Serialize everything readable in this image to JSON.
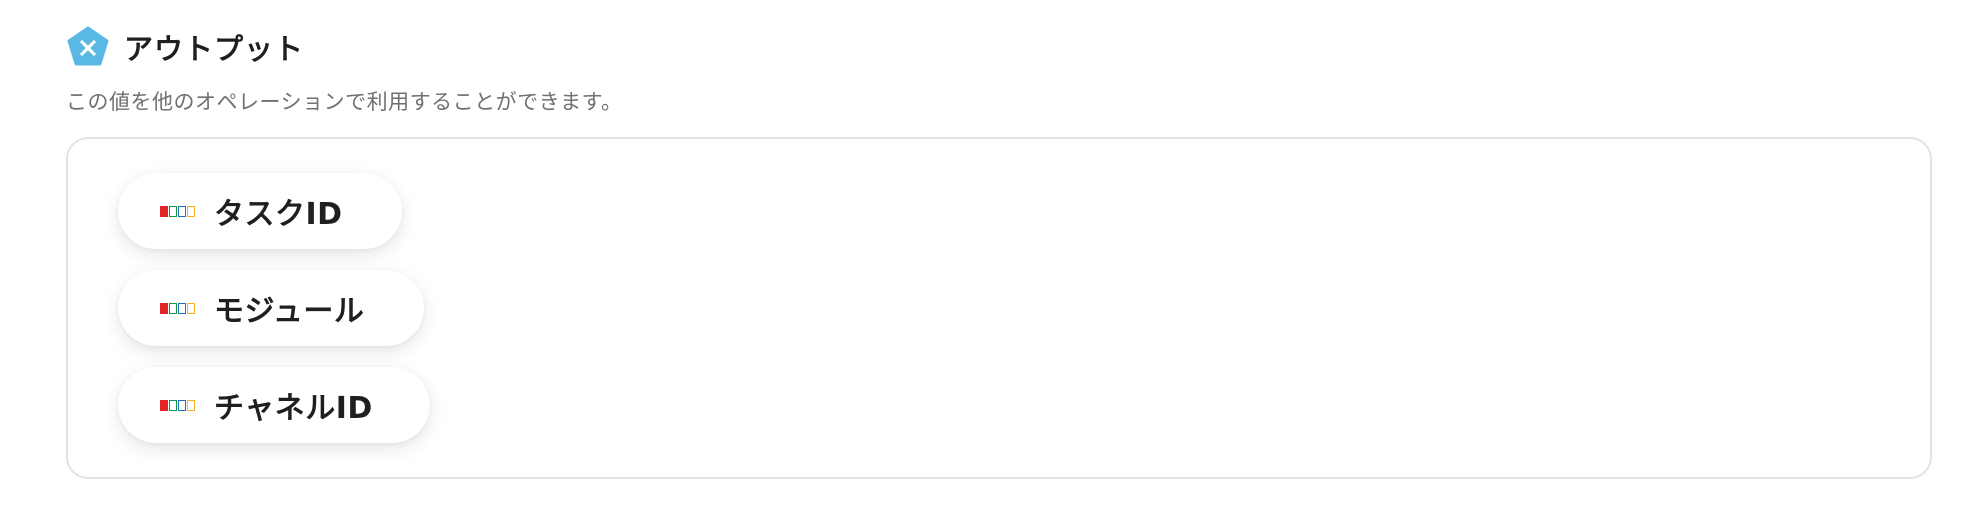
{
  "section": {
    "title": "アウトプット",
    "description": "この値を他のオペレーションで利用することができます。",
    "icon": "pentagon-close-icon",
    "icon_color": "#5ab8e4"
  },
  "outputs": [
    {
      "label": "タスクID",
      "icon": "zoho-logo-icon"
    },
    {
      "label": "モジュール",
      "icon": "zoho-logo-icon"
    },
    {
      "label": "チャネルID",
      "icon": "zoho-logo-icon"
    }
  ]
}
